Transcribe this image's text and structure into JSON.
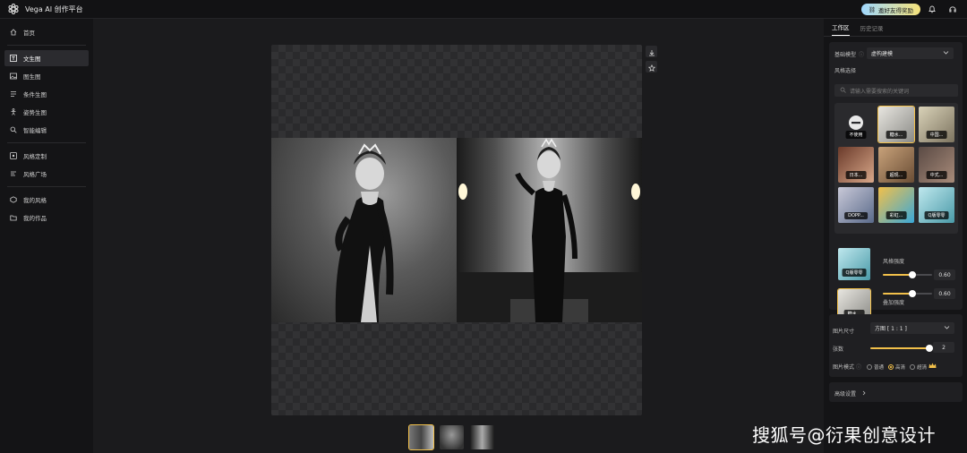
{
  "app": {
    "title": "Vega AI 创作平台"
  },
  "header": {
    "invite_label": "邀好友得奖励"
  },
  "sidebar": {
    "items": [
      {
        "label": "首页",
        "icon": "home-icon"
      },
      {
        "label": "文生图",
        "icon": "text-image-icon"
      },
      {
        "label": "图生图",
        "icon": "image-icon"
      },
      {
        "label": "条件生图",
        "icon": "condition-icon"
      },
      {
        "label": "姿势生图",
        "icon": "pose-icon"
      },
      {
        "label": "智能编辑",
        "icon": "smart-edit-icon"
      },
      {
        "label": "风格定制",
        "icon": "style-custom-icon"
      },
      {
        "label": "风格广场",
        "icon": "style-square-icon"
      },
      {
        "label": "我的风格",
        "icon": "my-style-icon"
      },
      {
        "label": "我的作品",
        "icon": "my-works-icon"
      }
    ]
  },
  "panel": {
    "tabs": [
      {
        "label": "工作区"
      },
      {
        "label": "历史记录"
      }
    ],
    "base_model": {
      "label": "基础模型",
      "value": "虚构建模"
    },
    "style": {
      "label": "风格选择",
      "search_placeholder": "请输入需要搜索的关键词",
      "tiles": [
        {
          "caption": "不使用"
        },
        {
          "caption": "糖水..."
        },
        {
          "caption": "中国..."
        },
        {
          "caption": "日本..."
        },
        {
          "caption": "超现..."
        },
        {
          "caption": "中式..."
        },
        {
          "caption": "DOPP..."
        },
        {
          "caption": "彩虹..."
        },
        {
          "caption": "Q版零零"
        }
      ]
    },
    "style_strength": {
      "caption": "Q版零零",
      "label": "风格强度",
      "value": "0.60",
      "fraction": 0.6
    },
    "overlay_strength": {
      "caption": "糖水...",
      "label": "叠加强度",
      "value": "0.60",
      "fraction": 0.6
    },
    "image_size": {
      "label": "图片尺寸",
      "value": "方图 [ 1 : 1 ]"
    },
    "count": {
      "label": "张数",
      "value": "2",
      "fraction": 1.0
    },
    "image_mode": {
      "label": "图片模式",
      "options": [
        "普通",
        "高清",
        "超清"
      ],
      "selected": "高清"
    },
    "advanced": {
      "label": "高级设置"
    }
  },
  "watermark": {
    "text": "搜狐号@衍果创意设计"
  }
}
